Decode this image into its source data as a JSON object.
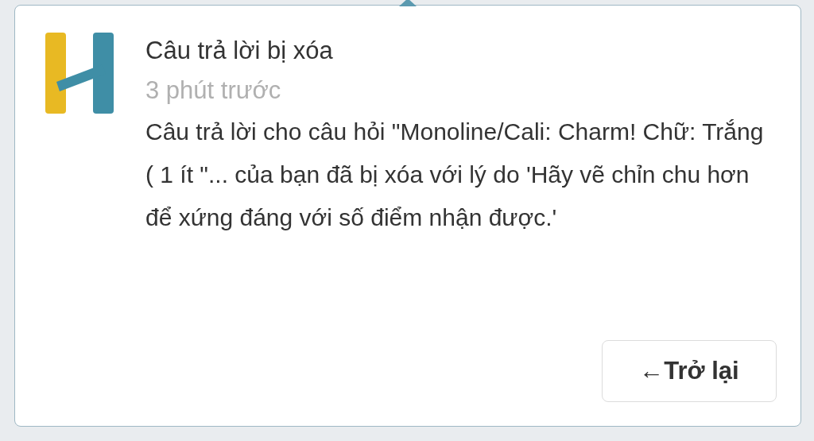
{
  "notification": {
    "title": "Câu trả lời bị xóa",
    "time": "3 phút trước",
    "message": "Câu trả lời cho câu hỏi \"Monoline/Cali: Charm! Chữ: Trắng ( 1 ít  \"... của bạn đã bị xóa với lý do 'Hãy vẽ chỉn chu hơn để xứng đáng với số điểm nhận được.'"
  },
  "buttons": [
    "←Trở lại"
  ]
}
